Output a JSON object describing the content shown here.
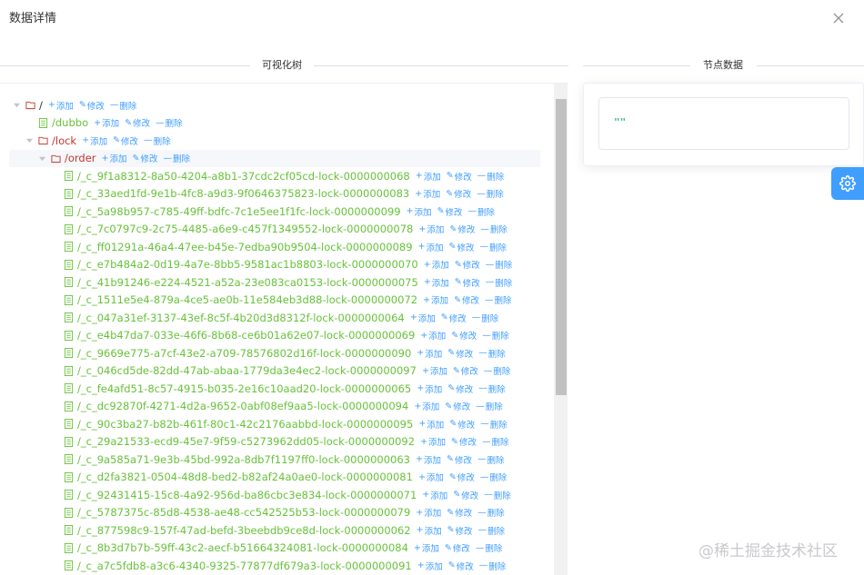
{
  "dialog": {
    "title": "数据详情"
  },
  "tree_section": {
    "title": "可视化树"
  },
  "node_section": {
    "title": "节点数据",
    "value": "\"\""
  },
  "actions": {
    "add": "添加",
    "edit": "修改",
    "delete": "删除"
  },
  "tree": {
    "root": "/",
    "dubbo": "/dubbo",
    "lock": "/lock",
    "order": "/order",
    "order_children": [
      "/_c_9f1a8312-8a50-4204-a8b1-37cdc2cf05cd-lock-0000000068",
      "/_c_33aed1fd-9e1b-4fc8-a9d3-9f0646375823-lock-0000000083",
      "/_c_5a98b957-c785-49ff-bdfc-7c1e5ee1f1fc-lock-0000000099",
      "/_c_7c0797c9-2c75-4485-a6e9-c457f1349552-lock-0000000078",
      "/_c_ff01291a-46a4-47ee-b45e-7edba90b9504-lock-0000000089",
      "/_c_e7b484a2-0d19-4a7e-8bb5-9581ac1b8803-lock-0000000070",
      "/_c_41b91246-e224-4521-a52a-23e083ca0153-lock-0000000075",
      "/_c_1511e5e4-879a-4ce5-ae0b-11e584eb3d88-lock-0000000072",
      "/_c_047a31ef-3137-43ef-8c5f-4b20d3d8312f-lock-0000000064",
      "/_c_e4b47da7-033e-46f6-8b68-ce6b01a62e07-lock-0000000069",
      "/_c_9669e775-a7cf-43e2-a709-78576802d16f-lock-0000000090",
      "/_c_046cd5de-82dd-47ab-abaa-1779da3e4ec2-lock-0000000097",
      "/_c_fe4afd51-8c57-4915-b035-2e16c10aad20-lock-0000000065",
      "/_c_dc92870f-4271-4d2a-9652-0abf08ef9aa5-lock-0000000094",
      "/_c_90c3ba27-b82b-461f-80c1-42c2176aabbd-lock-0000000095",
      "/_c_29a21533-ecd9-45e7-9f59-c5273962dd05-lock-0000000092",
      "/_c_9a585a71-9e3b-45bd-992a-8db7f1197ff0-lock-0000000063",
      "/_c_d2fa3821-0504-48d8-bed2-b82af24a0ae0-lock-0000000081",
      "/_c_92431415-15c8-4a92-956d-ba86cbc3e834-lock-0000000071",
      "/_c_5787375c-85d8-4538-ae48-cc542525b53-lock-0000000079",
      "/_c_877598c9-157f-47ad-befd-3beebdb9ce8d-lock-0000000062",
      "/_c_8b3d7b7b-59ff-43c2-aecf-b51664324081-lock-0000000084",
      "/_c_a7c5fdb8-a3c6-4340-9325-77877df679a3-lock-0000000091"
    ]
  },
  "watermark": "@稀土掘金技术社区",
  "icons": {
    "close": "close-icon",
    "folder": "folder-icon",
    "file": "file-icon",
    "caret": "caret-down-icon",
    "gear": "gear-icon",
    "add": "plus-icon",
    "edit": "pencil-icon",
    "delete": "minus-icon"
  },
  "colors": {
    "accent": "#409eff",
    "leaf_node": "#67c23a",
    "dir_node": "#c0392b",
    "json_value": "#42b983"
  }
}
